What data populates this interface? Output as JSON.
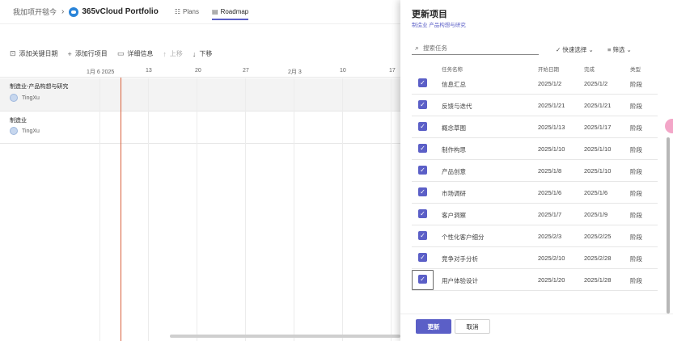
{
  "breadcrumb": {
    "parent": "我加项开毯今",
    "title": "365vCloud Portfolio"
  },
  "tabs": [
    {
      "label": "Plans",
      "icon": "plans-icon",
      "active": false
    },
    {
      "label": "Roadmap",
      "icon": "roadmap-icon",
      "active": true
    }
  ],
  "toolbar": {
    "add_milestone": "添加关键日期",
    "add_row": "添加行项目",
    "details": "详细信息",
    "move_up": "上移",
    "move_down": "下移"
  },
  "timeline": {
    "dates": [
      "1月 6 2025",
      "13",
      "20",
      "27",
      "2月 3",
      "10",
      "17"
    ]
  },
  "rows": [
    {
      "title": "制造业-产品构想与研究",
      "owner": "TingXu"
    },
    {
      "title": "制造业",
      "owner": "TingXu"
    }
  ],
  "panel": {
    "title": "更新项目",
    "subtitle": "制造业 产品构想与研究",
    "search_placeholder": "搜索任务",
    "quick_select": "快速选择",
    "filter": "筛选",
    "columns": {
      "name": "任务名称",
      "start": "开始日期",
      "end": "完成",
      "type": "类型"
    },
    "tasks": [
      {
        "name": "信息汇总",
        "start": "2025/1/2",
        "end": "2025/1/2",
        "type": "阶段",
        "checked": true
      },
      {
        "name": "反馈与迭代",
        "start": "2025/1/21",
        "end": "2025/1/21",
        "type": "阶段",
        "checked": true
      },
      {
        "name": "概念草图",
        "start": "2025/1/13",
        "end": "2025/1/17",
        "type": "阶段",
        "checked": true
      },
      {
        "name": "制作构思",
        "start": "2025/1/10",
        "end": "2025/1/10",
        "type": "阶段",
        "checked": true
      },
      {
        "name": "产品创意",
        "start": "2025/1/8",
        "end": "2025/1/10",
        "type": "阶段",
        "checked": true
      },
      {
        "name": "市场调研",
        "start": "2025/1/6",
        "end": "2025/1/6",
        "type": "阶段",
        "checked": true
      },
      {
        "name": "客户洞察",
        "start": "2025/1/7",
        "end": "2025/1/9",
        "type": "阶段",
        "checked": true
      },
      {
        "name": "个性化客户细分",
        "start": "2025/2/3",
        "end": "2025/2/25",
        "type": "阶段",
        "checked": true
      },
      {
        "name": "竞争对手分析",
        "start": "2025/2/10",
        "end": "2025/2/28",
        "type": "阶段",
        "checked": true
      },
      {
        "name": "用户体验设计",
        "start": "2025/1/20",
        "end": "2025/1/28",
        "type": "阶段",
        "checked": true,
        "focused": true
      }
    ],
    "update_button": "更新",
    "cancel_button": "取消"
  }
}
